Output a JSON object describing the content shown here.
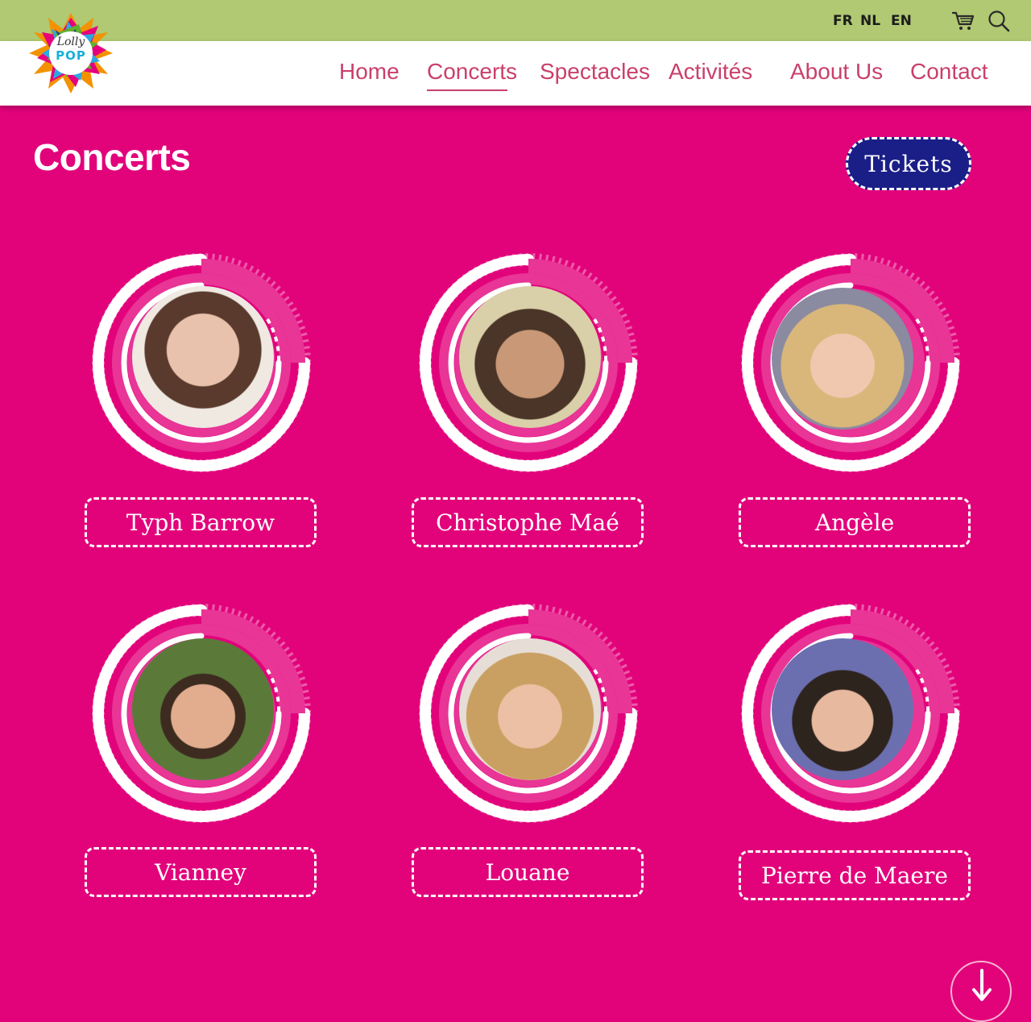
{
  "brand": {
    "logo_line1": "Lolly",
    "logo_line2": "POP"
  },
  "languages": [
    "FR",
    "NL",
    "EN"
  ],
  "icons": {
    "cart": "cart-icon",
    "search": "search-icon",
    "scroll": "arrow-down-icon"
  },
  "nav": [
    {
      "label": "Home"
    },
    {
      "label": "Concerts",
      "active": true
    },
    {
      "label": "Spectacles"
    },
    {
      "label": "Activités"
    },
    {
      "label": "About Us"
    },
    {
      "label": "Contact"
    }
  ],
  "page": {
    "title": "Concerts",
    "tickets_label": "Tickets"
  },
  "artists": [
    {
      "name": "Typh Barrow"
    },
    {
      "name": "Christophe Maé"
    },
    {
      "name": "Angèle"
    },
    {
      "name": "Vianney"
    },
    {
      "name": "Louane"
    },
    {
      "name": "Pierre de Maere"
    }
  ],
  "colors": {
    "topbar": "#b0c972",
    "background": "#e2037b",
    "nav_text": "#c9406b",
    "tickets_button": "#1a1f87",
    "text_light": "#ffffff"
  }
}
